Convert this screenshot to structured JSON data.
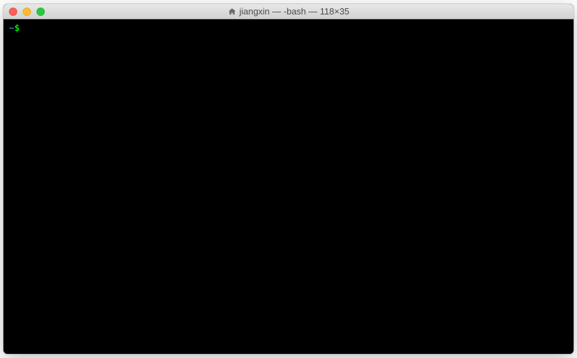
{
  "window": {
    "title": "jiangxin — -bash — 118×35"
  },
  "terminal": {
    "prompt": {
      "path": "~",
      "symbol": "$"
    }
  }
}
